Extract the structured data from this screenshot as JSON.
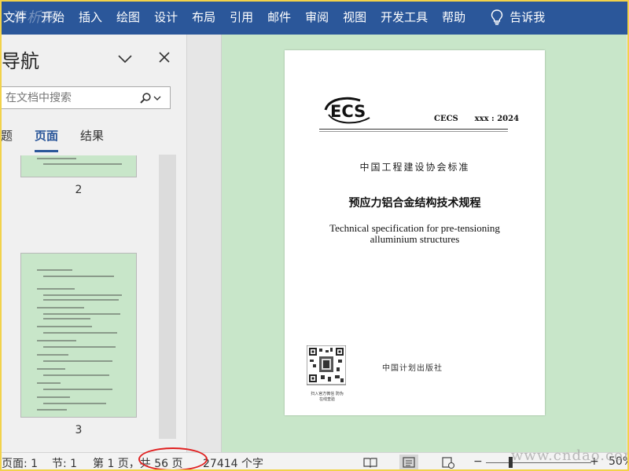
{
  "ribbon": {
    "tabs": [
      "文件",
      "开始",
      "插入",
      "绘图",
      "设计",
      "布局",
      "引用",
      "邮件",
      "审阅",
      "视图",
      "开发工具",
      "帮助"
    ],
    "tell_me": "告诉我",
    "watermark": "清析网"
  },
  "nav": {
    "title": "导航",
    "search_placeholder": "在文档中搜索",
    "tabs": [
      "标题",
      "页面",
      "结果"
    ],
    "active_tab": "页面",
    "thumb_labels": [
      "2",
      "3"
    ]
  },
  "document": {
    "logo_text": "ECS",
    "code": "CECS      xxx : 2024",
    "association": "中国工程建设协会标准",
    "title_cn": "预应力铝合金结构技术规程",
    "title_en_1": "Technical specification for pre-tensioning",
    "title_en_2": "alluminium structures",
    "qr_caption": "扫入官方微信 防伪在线查验",
    "publisher": "中国计划出版社"
  },
  "status": {
    "page": "页面: 1",
    "section": "节: 1",
    "page_of": "第 1 页，共 56 页",
    "words": "27414 个字",
    "zoom_minus": "−",
    "zoom_plus": "+",
    "zoom": "50%",
    "watermark": "www.cndao.com"
  },
  "colors": {
    "ribbon": "#2b579a",
    "canvas": "#c8e6c9",
    "highlight": "#e02020"
  }
}
